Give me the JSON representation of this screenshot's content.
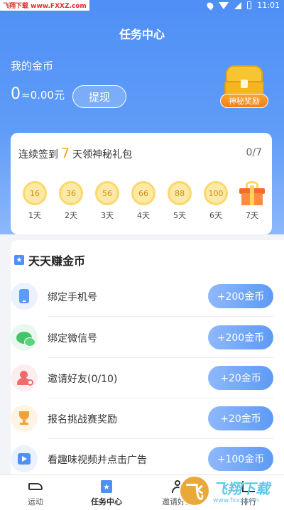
{
  "status_bar": {
    "watermark": "飞翔下载 www.FXXZ.com",
    "time": "11:01"
  },
  "header": {
    "title": "任务中心"
  },
  "coins": {
    "label": "我的金币",
    "amount": "0",
    "approx": "≈0.00元",
    "withdraw_label": "提现"
  },
  "mystery_box": {
    "tag": "神秘奖励"
  },
  "signin": {
    "prefix": "连续签到",
    "days_num": "7",
    "suffix": "天领神秘礼包",
    "progress": "0/7",
    "days": [
      {
        "coins": "16",
        "label": "1天"
      },
      {
        "coins": "36",
        "label": "2天"
      },
      {
        "coins": "56",
        "label": "3天"
      },
      {
        "coins": "66",
        "label": "4天"
      },
      {
        "coins": "88",
        "label": "5天"
      },
      {
        "coins": "100",
        "label": "6天"
      },
      {
        "coins": "",
        "label": "7天"
      }
    ]
  },
  "earn": {
    "title": "天天赚金币",
    "tasks": [
      {
        "label": "绑定手机号",
        "reward": "+200金币",
        "icon": "phone-icon",
        "icon_bg": "#eaf2fe"
      },
      {
        "label": "绑定微信号",
        "reward": "+200金币",
        "icon": "wechat-icon",
        "icon_bg": "#e9f7ee"
      },
      {
        "label": "邀请好友(0/10)",
        "reward": "+20金币",
        "icon": "invite-user-icon",
        "icon_bg": "#fdeeee"
      },
      {
        "label": "报名挑战赛奖励",
        "reward": "+20金币",
        "icon": "trophy-icon",
        "icon_bg": "#fef4e6"
      },
      {
        "label": "看趣味视频并点击广告",
        "reward": "+100金币",
        "icon": "video-icon",
        "icon_bg": "#eaf2fe"
      }
    ]
  },
  "bottom_nav": [
    {
      "label": "运动",
      "icon": "shoe-icon"
    },
    {
      "label": "任务中心",
      "icon": "task-star-icon",
      "active": true
    },
    {
      "label": "邀请好友",
      "icon": "person-icon"
    },
    {
      "label": "排行",
      "icon": "bars-icon"
    }
  ],
  "watermark": {
    "logo": "飞",
    "name": "飞翔下载",
    "url": "www.fxxz.com"
  },
  "colors": {
    "primary": "#4f8ff6",
    "accent": "#f5a623"
  }
}
